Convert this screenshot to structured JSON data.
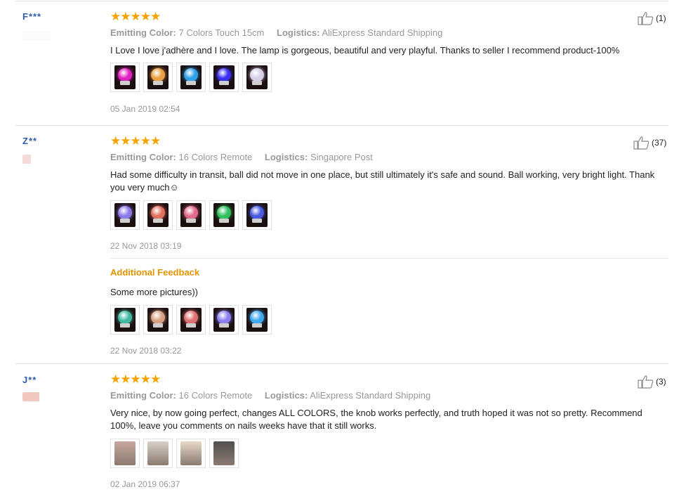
{
  "reviews": [
    {
      "user": "F***",
      "stars": "★★★★★",
      "color_label": "Emitting Color:",
      "color_value": "7 Colors Touch 15cm",
      "logistics_label": "Logistics:",
      "logistics_value": "AliExpress Standard Shipping",
      "text": "I Love I love j'adhère and I love. The lamp is gorgeous, beautiful and very playful. Thanks to seller I recommend product-100%",
      "likes": "(1)",
      "date": "05 Jan 2019 02:54",
      "photo_colors": [
        "#e020c0",
        "#e8a040",
        "#30a0e8",
        "#3a30f0",
        "#d8d0e8"
      ]
    },
    {
      "user": "Z**",
      "stars": "★★★★★",
      "color_label": "Emitting Color:",
      "color_value": "16 Colors Remote",
      "logistics_label": "Logistics:",
      "logistics_value": "Singapore Post",
      "text": "Had some difficulty in transit, ball did not move in one place, but still ultimately it's safe and sound. Ball working, very bright light. Thank you very much☺",
      "likes": "(37)",
      "date": "22 Nov 2018 03:19",
      "photo_colors": [
        "#8a7ae8",
        "#e07060",
        "#e06a8a",
        "#30c060",
        "#4a5ae0"
      ],
      "additional": {
        "heading": "Additional Feedback",
        "text": "Some more pictures))",
        "date": "22 Nov 2018 03:22",
        "photo_colors": [
          "#40b8a0",
          "#d8a080",
          "#e07070",
          "#8a80f0",
          "#40a8f0"
        ]
      }
    },
    {
      "user": "J**",
      "stars": "★★★★★",
      "color_label": "Emitting Color:",
      "color_value": "16 Colors Remote",
      "logistics_label": "Logistics:",
      "logistics_value": "AliExpress Standard Shipping",
      "text": "Very nice, by now going perfect, changes ALL COLORS, the knob works perfectly, and truth hoped it was not so pretty. Recommend 100%, leave you comments on nails weeks have that it still works.",
      "likes": "(3)",
      "date": "02 Jan 2019 06:37",
      "photo_colors": [
        "#c8a8a0",
        "#d8d0c8",
        "#e8d8c8",
        "#505050"
      ]
    }
  ]
}
